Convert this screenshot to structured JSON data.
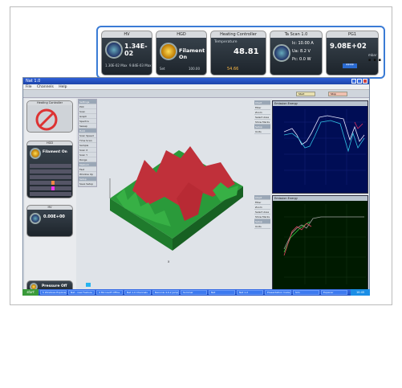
{
  "strip": {
    "widgets": [
      {
        "title": "HV",
        "value": "1.34E-02",
        "sub1": "1.30E-02 Max",
        "sub2": "9.84E-03 Max"
      },
      {
        "title": "HGD",
        "value": "Filament On",
        "sub1": "Set",
        "sub2": "100.00"
      },
      {
        "title": "Heating Controller",
        "label": "Temperature",
        "value": "48.81",
        "sub1": "54.66"
      },
      {
        "title": "Ta Scan 1.0",
        "line1": "Ic: 10.00  A",
        "line2": "Ua:  8.2   V",
        "line3": "Pc:  0.0   W"
      },
      {
        "title": "PG1",
        "value": "9.08E+02",
        "unit": "mbar",
        "sub1": "****"
      }
    ],
    "more": "..."
  },
  "window": {
    "title": "Nat 1.0",
    "menu": [
      "File",
      "Channels",
      "File",
      "Help"
    ],
    "toolbar": {
      "left_button": "Start",
      "right_button": "Stop"
    }
  },
  "sidebar": {
    "widget1_title": "Heating Controller",
    "widget2_title": "HGD",
    "widget2_value": "Filament On",
    "widget3_title": "HV",
    "widget3_value": "0.00E+00",
    "widget4_value": "Pressure Off"
  },
  "nav": [
    "Settings",
    "Plot",
    "Scan",
    "Graph",
    "Spectra",
    "Sweep",
    "Hold",
    "Scan Speed",
    "Time Scan",
    "Sample",
    "Scan X",
    "Scan Y",
    "Range",
    "Medium",
    "Fast",
    "Window Up",
    "Setup",
    "Save Setup"
  ],
  "right_nav_top": [
    "Chart",
    "Filter",
    "Zoom",
    "Select Area",
    "Show Marks",
    "Setup",
    "Units"
  ],
  "right_nav_bottom": [
    "Chart",
    "Filter",
    "Zoom",
    "Select Area",
    "Show Marks",
    "Setup",
    "Units"
  ],
  "graphs": {
    "top_title": "Emission Energy",
    "bottom_title": "Emission Energy"
  },
  "taskbar": {
    "start": "start",
    "items": [
      "5 Windows Explorer",
      "Nat - new Feature",
      "4 Microsoft Office",
      "Nat 1.0 Channels",
      "Nanonis 4.9.2 Jump",
      "Sommer",
      "Nat",
      "Nat 1.2",
      "Presentation mode",
      "Sim",
      "Explorer"
    ],
    "clock": "10:45"
  },
  "colors": {
    "accent": "#3a7bd5",
    "graph_bg": "#000d55",
    "terrain_high": "#c0303a",
    "terrain_low": "#2a9a3a"
  }
}
